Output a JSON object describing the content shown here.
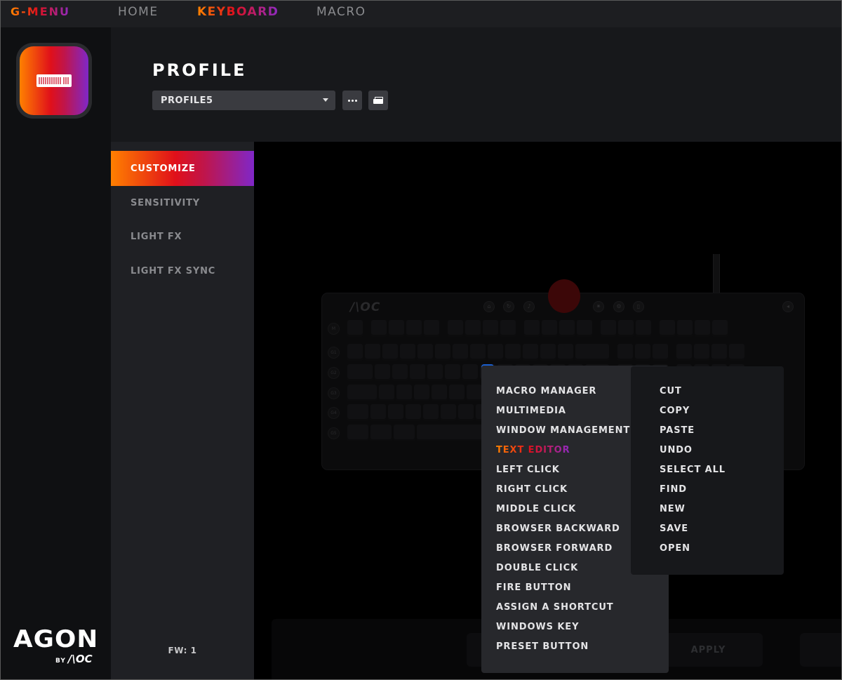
{
  "topnav": {
    "items": [
      {
        "label": "G-MENU",
        "active": false,
        "brand": true
      },
      {
        "label": "HOME",
        "active": false
      },
      {
        "label": "KEYBOARD",
        "active": true
      },
      {
        "label": "MACRO",
        "active": false
      }
    ]
  },
  "brand": {
    "logo_word": "AGON",
    "logo_by": "BY",
    "logo_maker": "/\\OC",
    "accent_gradient": [
      "#ff8000",
      "#e0101a",
      "#8027c8"
    ]
  },
  "device": {
    "icon": "keyboard-icon"
  },
  "header": {
    "title": "PROFILE",
    "profile_select": {
      "value": "PROFILE5"
    },
    "more_button_icon": "more-horizontal-icon",
    "folder_button_icon": "folder-open-icon"
  },
  "sidemenu": {
    "items": [
      {
        "label": "CUSTOMIZE",
        "active": true
      },
      {
        "label": "SENSITIVITY",
        "active": false
      },
      {
        "label": "LIGHT FX",
        "active": false
      },
      {
        "label": "LIGHT FX SYNC",
        "active": false
      }
    ],
    "firmware": "FW: 1"
  },
  "keyboard": {
    "brand": "/\\OC",
    "selected_key_color": "#1a5fd0",
    "g_keys": [
      "M",
      "G1",
      "G2",
      "G3",
      "G4",
      "G5"
    ]
  },
  "bottom_bar": {
    "apply_label": "APPLY"
  },
  "menu_primary": {
    "items": [
      {
        "label": "MACRO MANAGER",
        "active": false
      },
      {
        "label": "MULTIMEDIA",
        "active": false
      },
      {
        "label": "WINDOW MANAGEMENT",
        "active": false
      },
      {
        "label": "TEXT EDITOR",
        "active": true
      },
      {
        "label": "LEFT CLICK",
        "active": false
      },
      {
        "label": "RIGHT CLICK",
        "active": false
      },
      {
        "label": "MIDDLE CLICK",
        "active": false
      },
      {
        "label": "BROWSER BACKWARD",
        "active": false
      },
      {
        "label": "BROWSER FORWARD",
        "active": false
      },
      {
        "label": "DOUBLE CLICK",
        "active": false
      },
      {
        "label": "FIRE BUTTON",
        "active": false
      },
      {
        "label": "ASSIGN A SHORTCUT",
        "active": false
      },
      {
        "label": "WINDOWS KEY",
        "active": false
      },
      {
        "label": "PRESET BUTTON",
        "active": false
      }
    ]
  },
  "menu_secondary": {
    "items": [
      {
        "label": "CUT"
      },
      {
        "label": "COPY"
      },
      {
        "label": "PASTE"
      },
      {
        "label": "UNDO"
      },
      {
        "label": "SELECT ALL"
      },
      {
        "label": "FIND"
      },
      {
        "label": "NEW"
      },
      {
        "label": "SAVE"
      },
      {
        "label": "OPEN"
      }
    ]
  }
}
